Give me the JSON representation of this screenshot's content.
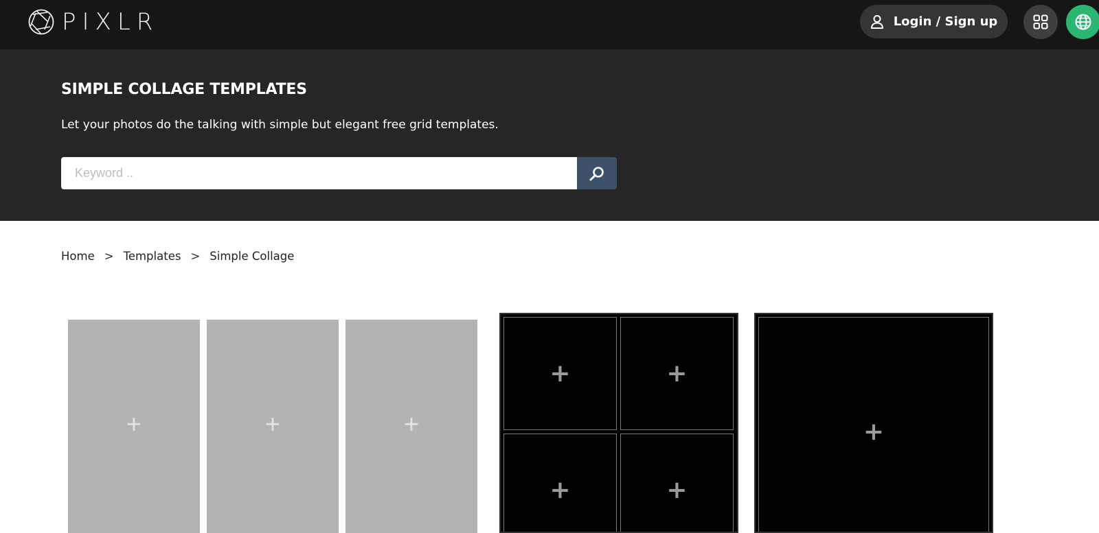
{
  "header": {
    "logo_text": "PIXLR",
    "login_label": "Login / Sign up",
    "icons": {
      "logo": "aperture-logo-icon",
      "login": "user-icon",
      "apps": "grid-icon",
      "language": "globe-icon"
    },
    "colors": {
      "bar": "#161616",
      "language_button": "#2bb673"
    }
  },
  "hero": {
    "title": "SIMPLE COLLAGE TEMPLATES",
    "subtitle": "Let your photos do the talking with simple but elegant free grid templates.",
    "search": {
      "placeholder": "Keyword ..",
      "value": "",
      "button_icon": "search-icon",
      "button_color": "#3d5268"
    }
  },
  "breadcrumb": {
    "items": [
      "Home",
      "Templates",
      "Simple Collage"
    ],
    "separator": ">"
  },
  "templates": [
    {
      "name": "three-column-gray",
      "slots": 3,
      "slot_label": "+",
      "color": "#b3b3b3"
    },
    {
      "name": "four-grid-black",
      "slots": 4,
      "slot_label": "+",
      "color": "#000000"
    },
    {
      "name": "single-black",
      "slots": 1,
      "slot_label": "+",
      "color": "#000000"
    }
  ]
}
